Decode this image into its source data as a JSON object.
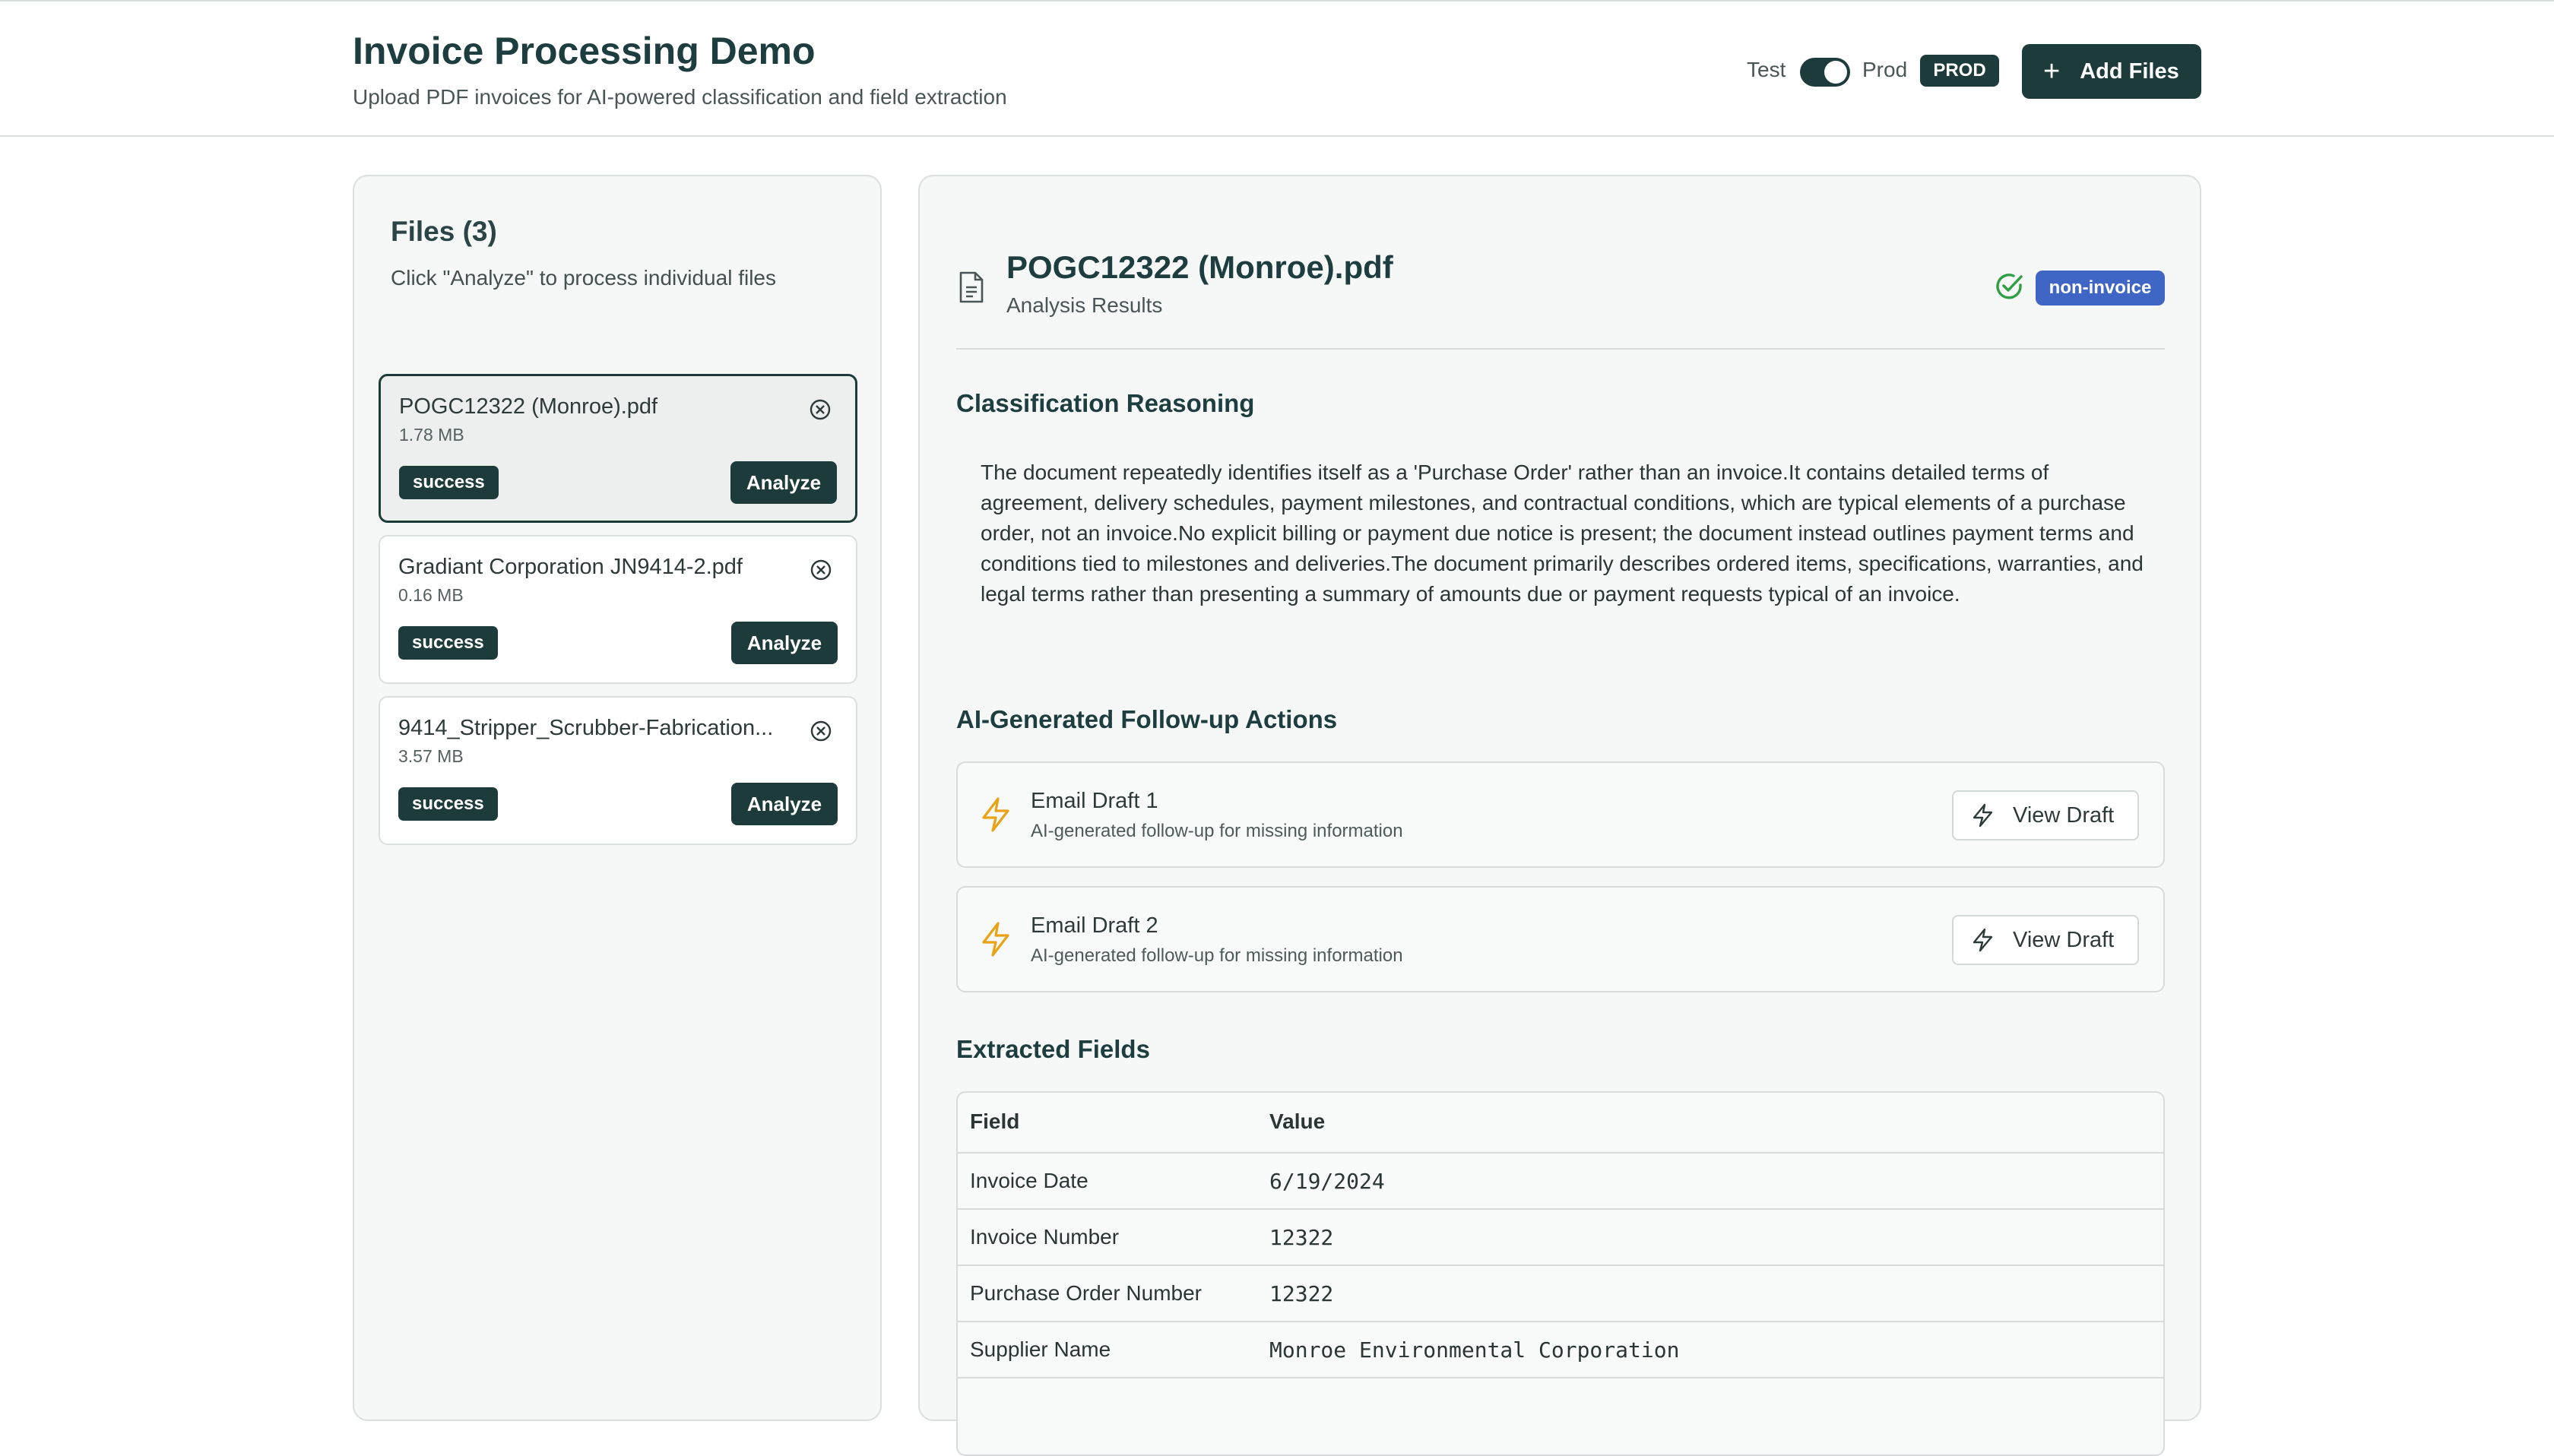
{
  "header": {
    "title": "Invoice Processing Demo",
    "subtitle": "Upload PDF invoices for AI-powered classification and field extraction",
    "mode_test_label": "Test",
    "mode_prod_label": "Prod",
    "mode_badge": "PROD",
    "add_files_label": "Add Files"
  },
  "files_panel": {
    "title": "Files (3)",
    "hint": "Click \"Analyze\" to process individual files",
    "files": [
      {
        "name": "POGC12322 (Monroe).pdf",
        "size": "1.78 MB",
        "status": "success",
        "analyze_label": "Analyze"
      },
      {
        "name": "Gradiant Corporation JN9414-2.pdf",
        "size": "0.16 MB",
        "status": "success",
        "analyze_label": "Analyze"
      },
      {
        "name": "9414_Stripper_Scrubber-Fabrication...",
        "size": "3.57 MB",
        "status": "success",
        "analyze_label": "Analyze"
      }
    ]
  },
  "results": {
    "title": "POGC12322 (Monroe).pdf",
    "subtitle": "Analysis Results",
    "classification": "non-invoice",
    "reasoning_title": "Classification Reasoning",
    "reasoning_text": "The document repeatedly identifies itself as a 'Purchase Order' rather than an invoice.It contains detailed terms of agreement, delivery schedules, payment milestones, and contractual conditions, which are typical elements of a purchase order, not an invoice.No explicit billing or payment due notice is present; the document instead outlines payment terms and conditions tied to milestones and deliveries.The document primarily describes ordered items, specifications, warranties, and legal terms rather than presenting a summary of amounts due or payment requests typical of an invoice.",
    "actions_title": "AI-Generated Follow-up Actions",
    "actions": [
      {
        "title": "Email Draft 1",
        "description": "AI-generated follow-up for missing information",
        "button_label": "View Draft"
      },
      {
        "title": "Email Draft 2",
        "description": "AI-generated follow-up for missing information",
        "button_label": "View Draft"
      }
    ],
    "fields_title": "Extracted Fields",
    "table_headers": {
      "field": "Field",
      "value": "Value"
    },
    "fields": [
      {
        "field": "Invoice Date",
        "value": "6/19/2024"
      },
      {
        "field": "Invoice Number",
        "value": "12322"
      },
      {
        "field": "Purchase Order Number",
        "value": "12322"
      },
      {
        "field": "Supplier Name",
        "value": "Monroe Environmental Corporation"
      }
    ]
  },
  "colors": {
    "primary": "#1e3b3c",
    "badge_blue": "#3f66c4",
    "bolt_orange": "#e8a317",
    "check_green": "#2f9e44"
  }
}
